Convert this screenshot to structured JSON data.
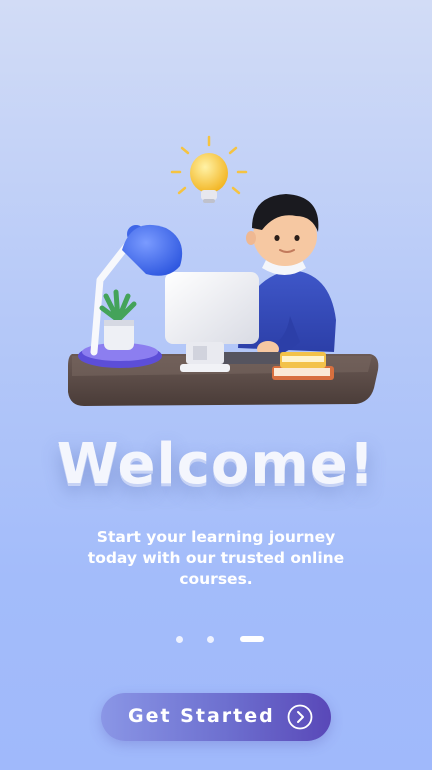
{
  "onboarding": {
    "title": "Welcome!",
    "subtitle": "Start your learning journey today with our trusted online courses.",
    "page_indicator": {
      "total": 3,
      "current": 3
    },
    "cta_label": "Get Started",
    "cta_icon": "chevron-right-circle-icon",
    "illustration": "person-at-desk-computer-illustration"
  },
  "colors": {
    "background_top": "#d2dcf6",
    "background_bottom": "#a0b9fb",
    "button_start": "#8a96e6",
    "button_end": "#5948b8",
    "text": "#ffffff"
  }
}
